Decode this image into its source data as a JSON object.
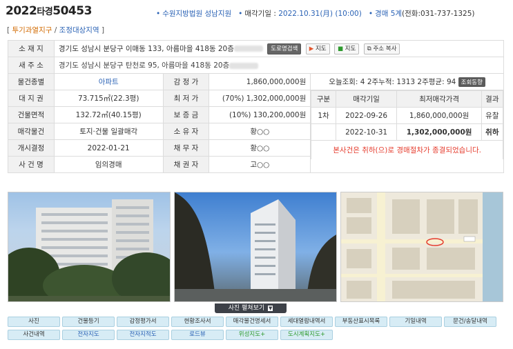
{
  "header": {
    "case_year": "2022",
    "case_type": "타경",
    "case_num": "50453",
    "court": "수원지방법원 성남지원",
    "sale_date_label": "매각기일 :",
    "sale_date": "2022.10.31(月) (10:00)",
    "dept": "경매 5계",
    "dept_phone": "(전화:031-737-1325)"
  },
  "tags": {
    "bracket_open": "[",
    "zone1": "투기과열지구",
    "sep": "/",
    "zone2": "조정대상지역",
    "bracket_close": "]"
  },
  "address": {
    "old_label": "소 재 지",
    "old": "경기도 성남시 분당구 이매동 133, 아름마을 418동 20층",
    "new_label": "새 주 소",
    "new": "경기도 성남시 분당구 탄천로 95, 아름마을 418동 20층",
    "btn_road": "도로명검색",
    "btn_map1": "지도",
    "btn_map2": "지도",
    "btn_copy": "주소 복사"
  },
  "rows": {
    "type_label": "물건종별",
    "type": "아파트",
    "appraisal_label": "감 정 가",
    "appraisal": "1,860,000,000원",
    "land_label": "대 지 권",
    "land": "73.715㎡(22.3평)",
    "min_label": "최 저 가",
    "min": "(70%) 1,302,000,000원",
    "area_label": "건물면적",
    "area": "132.72㎡(40.15평)",
    "deposit_label": "보 증 금",
    "deposit": "(10%) 130,200,000원",
    "sale_obj_label": "매각물건",
    "sale_obj": "토지·건물 일괄매각",
    "owner_label": "소 유 자",
    "owner": "황○○",
    "start_label": "개시결정",
    "start": "2022-01-21",
    "debtor_label": "채 무 자",
    "debtor": "황○○",
    "case_label": "사 건 명",
    "case_name": "임의경매",
    "creditor_label": "채 권 자",
    "creditor": "고○○"
  },
  "stats": {
    "text": "오늘조회: 4  2주누적: 1313  2주평균: 94",
    "btn": "조회동향"
  },
  "history": {
    "headers": [
      "구분",
      "매각기일",
      "최저매각가격",
      "결과"
    ],
    "rows": [
      [
        "1차",
        "2022-09-26",
        "1,860,000,000원",
        "유찰"
      ],
      [
        "",
        "2022-10-31",
        "1,302,000,000원",
        "취하"
      ]
    ],
    "notice": "본사건은 취하(으)로 경매절차가 종결되었습니다."
  },
  "photos_btn": "사진 펼쳐보기",
  "buttons_row1": [
    "사진",
    "건물등기",
    "감정평가서",
    "현황조사서",
    "매각물건명세서",
    "세대열람내역서",
    "부동산표시목록",
    "기일내역",
    "문건/송달내역"
  ],
  "buttons_row2": [
    "사건내역",
    "전자지도",
    "전자지적도",
    "로드뷰",
    "위성지도+",
    "도시계획지도+"
  ],
  "colors": {
    "accent_blue": "#2a62b5",
    "tag_orange": "#d26a00",
    "notice_red": "#e53b2c",
    "btn_bg": "#d7ecf5"
  }
}
